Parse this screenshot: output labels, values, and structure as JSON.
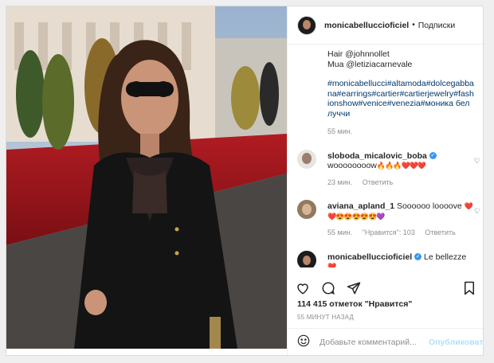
{
  "post": {
    "username": "monicabelluccioficiel",
    "dot": "•",
    "follow_label": "Подписки"
  },
  "caption": {
    "hair_line": "Hair @johnnollet",
    "mua_line": "Mua @letiziacarnevale",
    "hashtags": "#monicabellucci#altamoda#dolcegabbana#earrings#cartier#cartierjewelry#fashionshow#venice#venezia#моника беллуччи",
    "time": "55 мин."
  },
  "comments": [
    {
      "username": "sloboda_micalovic_boba",
      "verified": true,
      "text": "woooooooow",
      "emoji": "🔥🔥🔥❤️❤️❤️",
      "time": "23 мин.",
      "likes_label": "",
      "reply": "Ответить"
    },
    {
      "username": "aviana_apland_1",
      "verified": false,
      "text": "Soooooo loooove",
      "emoji": "❤️❤️😍😍😍😍😍💜",
      "time": "55 мин.",
      "likes_label": "\"Нравится\": 103",
      "reply": "Ответить"
    },
    {
      "username": "monicabelluccioficiel",
      "verified": true,
      "text": "Le bellezze",
      "emoji": "❤️",
      "time": "",
      "likes_label": "",
      "reply": ""
    }
  ],
  "actions": {
    "icons": [
      "heart-icon",
      "comment-icon",
      "share-icon",
      "bookmark-icon"
    ]
  },
  "likes": {
    "text": "114 415 отметок \"Нравится\""
  },
  "time_ago": "55 минут назад",
  "add_comment": {
    "placeholder": "Добавьте комментарий...",
    "publish_label": "Опубликовать"
  },
  "colors": {
    "link": "#00376b",
    "verified": "#3897f0",
    "muted": "#8e8e8e",
    "publish_disabled": "#b2dffc"
  }
}
